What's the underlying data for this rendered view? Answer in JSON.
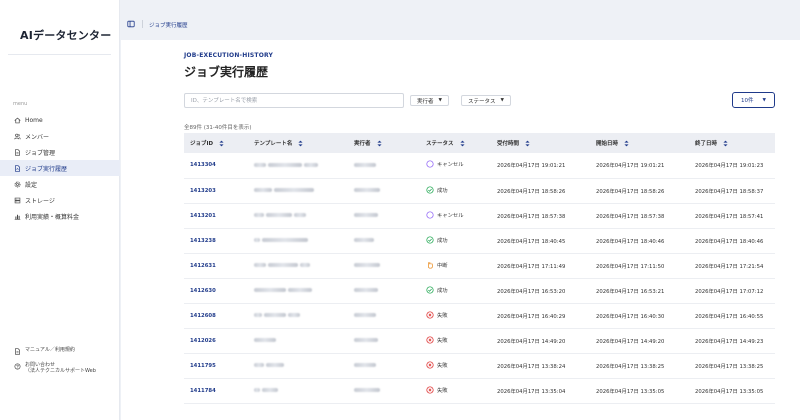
{
  "app": {
    "title": "AIデータセンター"
  },
  "breadcrumb": "ジョブ実行履歴",
  "page": {
    "eyebrow": "JOB-EXECUTION-HISTORY",
    "title": "ジョブ実行履歴"
  },
  "sidebar": {
    "menu_heading": "menu",
    "items": [
      {
        "label": "Home",
        "icon": "home-icon",
        "active": false
      },
      {
        "label": "メンバー",
        "icon": "members-icon",
        "active": false
      },
      {
        "label": "ジョブ管理",
        "icon": "document-icon",
        "active": false
      },
      {
        "label": "ジョブ実行履歴",
        "icon": "history-icon",
        "active": true
      },
      {
        "label": "設定",
        "icon": "gear-icon",
        "active": false
      },
      {
        "label": "ストレージ",
        "icon": "storage-icon",
        "active": false
      },
      {
        "label": "利用実績・概算料金",
        "icon": "chart-icon",
        "active": false
      }
    ],
    "bottom": [
      {
        "label": "マニュアル／利用規約",
        "icon": "manual-icon"
      },
      {
        "label": "お問い合わせ",
        "sub": "（法人テクニカルサポートWeb",
        "icon": "help-icon"
      }
    ]
  },
  "filters": {
    "search_placeholder": "ID、テンプレート名で検索",
    "executor_label": "実行者",
    "status_label": "ステータス",
    "page_size": "10件"
  },
  "result_count": "全89件 (31-40件目を表示)",
  "table": {
    "columns": [
      "ジョブID",
      "テンプレート名",
      "実行者",
      "ステータス",
      "受付時間",
      "開始日時",
      "終了日時"
    ],
    "rows": [
      {
        "id": "1413304",
        "status": "キャンセル",
        "status_type": "cancel",
        "received": "2026年04月17日 19:01:21",
        "start": "2026年04月17日 19:01:21",
        "end": "2026年04月17日 19:01:23"
      },
      {
        "id": "1413203",
        "status": "成功",
        "status_type": "success",
        "received": "2026年04月17日 18:58:26",
        "start": "2026年04月17日 18:58:26",
        "end": "2026年04月17日 18:58:37"
      },
      {
        "id": "1413201",
        "status": "キャンセル",
        "status_type": "cancel",
        "received": "2026年04月17日 18:57:38",
        "start": "2026年04月17日 18:57:38",
        "end": "2026年04月17日 18:57:41"
      },
      {
        "id": "1413238",
        "status": "成功",
        "status_type": "success",
        "received": "2026年04月17日 18:40:45",
        "start": "2026年04月17日 18:40:46",
        "end": "2026年04月17日 18:40:46"
      },
      {
        "id": "1412631",
        "status": "中断",
        "status_type": "interrupt",
        "received": "2026年04月17日 17:11:49",
        "start": "2026年04月17日 17:11:50",
        "end": "2026年04月17日 17:21:54"
      },
      {
        "id": "1412630",
        "status": "成功",
        "status_type": "success",
        "received": "2026年04月17日 16:53:20",
        "start": "2026年04月17日 16:53:21",
        "end": "2026年04月17日 17:07:12"
      },
      {
        "id": "1412608",
        "status": "失敗",
        "status_type": "fail",
        "received": "2026年04月17日 16:40:29",
        "start": "2026年04月17日 16:40:30",
        "end": "2026年04月17日 16:40:55"
      },
      {
        "id": "1412026",
        "status": "失敗",
        "status_type": "fail",
        "received": "2026年04月17日 14:49:20",
        "start": "2026年04月17日 14:49:20",
        "end": "2026年04月17日 14:49:23"
      },
      {
        "id": "1411795",
        "status": "失敗",
        "status_type": "fail",
        "received": "2026年04月17日 13:38:24",
        "start": "2026年04月17日 13:38:25",
        "end": "2026年04月17日 13:38:25"
      },
      {
        "id": "1411784",
        "status": "失敗",
        "status_type": "fail",
        "received": "2026年04月17日 13:35:04",
        "start": "2026年04月17日 13:35:05",
        "end": "2026年04月17日 13:35:05"
      }
    ]
  },
  "colors": {
    "accent": "#1f3a8a",
    "cancel": "#8b5cf6",
    "success": "#16a34a",
    "interrupt": "#ea8a1c",
    "fail": "#dc2626"
  }
}
